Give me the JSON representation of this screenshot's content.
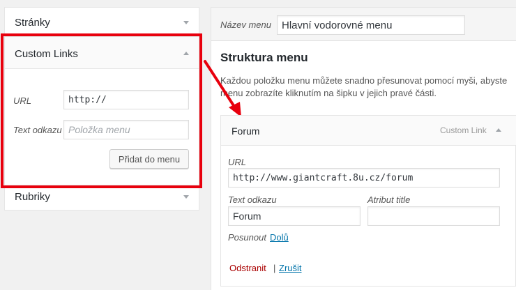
{
  "left_panel": {
    "pages_box": {
      "title": "Stránky"
    },
    "custom_links_box": {
      "title": "Custom Links",
      "url_label": "URL",
      "url_value": "http://",
      "link_text_label": "Text odkazu",
      "link_text_placeholder": "Položka menu",
      "add_button": "Přidat do menu"
    },
    "categories_box": {
      "title": "Rubriky"
    }
  },
  "right_panel": {
    "menu_name_label": "Název menu",
    "menu_name_value": "Hlavní vodorovné menu",
    "structure_title": "Struktura menu",
    "help_line1": "Každou položku menu můžete snadno přesunovat pomocí myši, abyste",
    "help_line2": "menu zobrazíte kliknutím na šipku v jejich pravé části.",
    "menu_item": {
      "title": "Forum",
      "type": "Custom Link",
      "url_label": "URL",
      "url_value": "http://www.giantcraft.8u.cz/forum",
      "link_text_label": "Text odkazu",
      "link_text_value": "Forum",
      "title_attr_label": "Atribut title",
      "title_attr_value": "",
      "move_label": "Posunout",
      "move_down_link": "Dolů",
      "delete_link": "Odstranit",
      "separator": "|",
      "cancel_link": "Zrušit"
    }
  },
  "colors": {
    "highlight_frame": "#e8000d",
    "link": "#0073aa",
    "delete": "#aa0000"
  }
}
